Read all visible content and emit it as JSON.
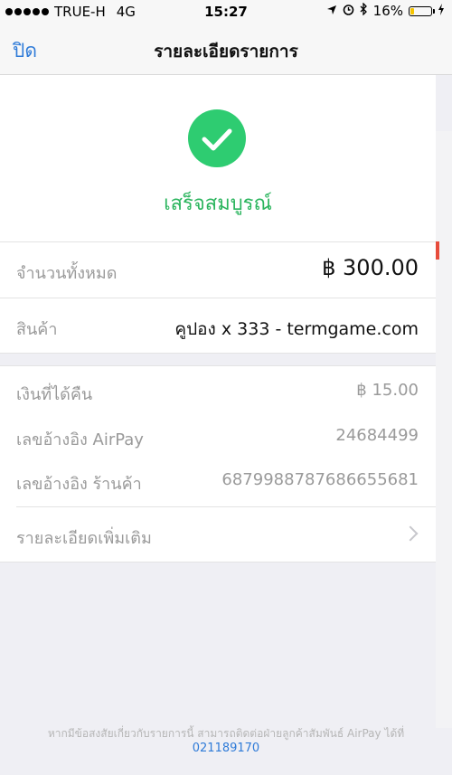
{
  "status_bar": {
    "carrier": "TRUE-H",
    "network": "4G",
    "time": "15:27",
    "battery": "16%",
    "battery_level": 0.16
  },
  "nav": {
    "close_label": "ปิด",
    "title": "รายละเอียดรายการ"
  },
  "success": {
    "text": "เสร็จสมบูรณ์",
    "color": "#2ecc71"
  },
  "summary": {
    "total_label": "จำนวนทั้งหมด",
    "total_value": "฿ 300.00",
    "product_label": "สินค้า",
    "product_value": "คูปอง x 333 - termgame.com"
  },
  "details": {
    "cashback_label": "เงินที่ได้คืน",
    "cashback_value": "฿ 15.00",
    "airpay_ref_label": "เลขอ้างอิง AirPay",
    "airpay_ref_value": "24684499",
    "merchant_ref_label": "เลขอ้างอิง ร้านค้า",
    "merchant_ref_value": "6879988787686655681",
    "more_label": "รายละเอียดเพิ่มเติม"
  },
  "footer": {
    "text": "หากมีข้อสงสัยเกี่ยวกับรายการนี้ สามารถติดต่อฝ่ายลูกค้าสัมพันธ์ AirPay ได้ที่",
    "phone": "021189170"
  },
  "colors": {
    "accent": "#2f7bd8",
    "success": "#2ecc71"
  }
}
